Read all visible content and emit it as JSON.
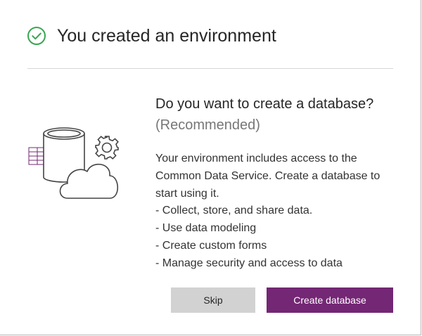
{
  "dialog": {
    "title": "You created an environment",
    "question": "Do you want to create a database?",
    "recommended": "(Recommended)",
    "description": [
      "Your environment includes access to the Common Data Service. Create a database to start using it.",
      "- Collect, store, and share data.",
      "- Use data modeling",
      "- Create custom forms",
      "- Manage security and access to data"
    ],
    "buttons": {
      "skip": "Skip",
      "create": "Create database"
    }
  },
  "icons": {
    "success": "check-circle-icon",
    "illustration": "database-cloud-illustration"
  },
  "colors": {
    "success": "#3aa652",
    "accent": "#742774",
    "skip_button": "#d2d2d2"
  }
}
